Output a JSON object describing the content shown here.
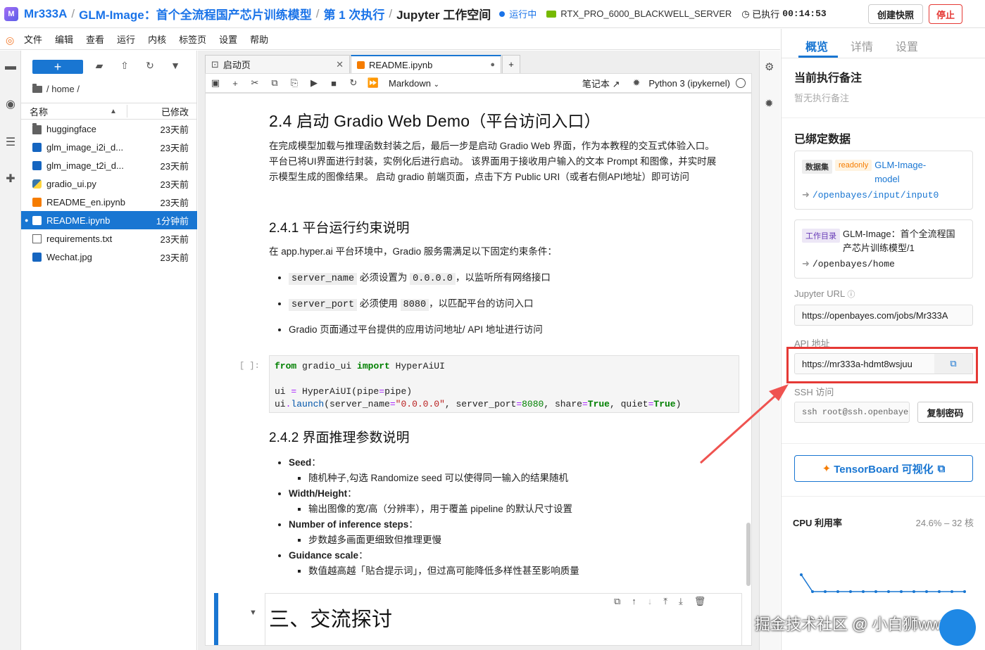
{
  "topbar": {
    "logo_text": "M",
    "user": "Mr333A",
    "project": "GLM-Image：首个全流程国产芯片训练模型",
    "run": "第 1 次执行",
    "workspace": "Jupyter 工作空间",
    "status": "运行中",
    "gpu": "RTX_PRO_6000_BLACKWELL_SERVER",
    "elapsed_label": "已执行",
    "elapsed": "00:14:53",
    "snapshot_button": "创建快照",
    "stop_button": "停止"
  },
  "menu": [
    "文件",
    "编辑",
    "查看",
    "运行",
    "内核",
    "标签页",
    "设置",
    "帮助"
  ],
  "filebrowser": {
    "path": "/ home /",
    "col_name": "名称",
    "col_modified": "已修改",
    "files": [
      {
        "name": "huggingface",
        "time": "23天前",
        "type": "folder"
      },
      {
        "name": "glm_image_i2i_d...",
        "time": "23天前",
        "type": "image"
      },
      {
        "name": "glm_image_t2i_d...",
        "time": "23天前",
        "type": "image"
      },
      {
        "name": "gradio_ui.py",
        "time": "23天前",
        "type": "python"
      },
      {
        "name": "README_en.ipynb",
        "time": "23天前",
        "type": "notebook"
      },
      {
        "name": "README.ipynb",
        "time": "1分钟前",
        "type": "notebook",
        "selected": true
      },
      {
        "name": "requirements.txt",
        "time": "23天前",
        "type": "text"
      },
      {
        "name": "Wechat.jpg",
        "time": "23天前",
        "type": "image"
      }
    ]
  },
  "tabs": [
    {
      "label": "启动页"
    },
    {
      "label": "README.ipynb"
    }
  ],
  "toolbar": {
    "cell_type": "Markdown",
    "notebook_label": "笔记本",
    "kernel": "Python 3 (ipykernel)"
  },
  "notebook": {
    "h_24": "2.4 启动 Gradio Web Demo（平台访问入口）",
    "p_24": "在完成模型加载与推理函数封装之后，最后一步是启动 Gradio Web 界面，作为本教程的交互式体验入口。 平台已将UI界面进行封装，实例化后进行启动。 该界面用于接收用户输入的文本 Prompt 和图像，并实时展示模型生成的图像结果。 启动 gradio 前端页面，点击下方 Public URI（或者右侧API地址）即可访问",
    "h_241": "2.4.1 平台运行约束说明",
    "p_241": "在 app.hyper.ai 平台环境中，Gradio 服务需满足以下固定约束条件：",
    "b1_code": "server_name",
    "b1_mid": "必须设置为",
    "b1_val": "0.0.0.0",
    "b1_tail": "，以监听所有网络接口",
    "b2_code": "server_port",
    "b2_mid": "必须使用",
    "b2_val": "8080",
    "b2_tail": "，以匹配平台的访问入口",
    "b3": "Gradio 页面通过平台提供的应用访问地址/ API 地址进行访问",
    "prompt": "[ ]:",
    "h_242": "2.4.2 界面推理参数说明",
    "params": [
      {
        "name": "Seed",
        "desc": "随机种子,勾选 Randomize seed 可以使得同一输入的结果随机"
      },
      {
        "name": "Width/Height",
        "desc": "输出图像的宽/高（分辨率），用于覆盖 pipeline 的默认尺寸设置"
      },
      {
        "name": "Number of inference steps",
        "desc": "步数越多画面更细致但推理更慢"
      },
      {
        "name": "Guidance scale",
        "desc": "数值越高越「贴合提示词」，但过高可能降低多样性甚至影响质量"
      }
    ],
    "h_3": "三、交流探讨"
  },
  "panel": {
    "tabs": [
      "概览",
      "详情",
      "设置"
    ],
    "note_title": "当前执行备注",
    "note_empty": "暂无执行备注",
    "data_title": "已绑定数据",
    "dataset_tag": "数据集",
    "readonly_tag": "readonly",
    "dataset_name": "GLM-Image-model",
    "dataset_path": "/openbayes/input/input0",
    "workdir_tag": "工作目录",
    "workdir_name": "GLM-Image：首个全流程国产芯片训练模型/1",
    "workdir_path": "/openbayes/home",
    "jupyter_label": "Jupyter URL",
    "jupyter_url": "https://openbayes.com/jobs/Mr333A",
    "api_label": "API 地址",
    "api_url": "https://mr333a-hdmt8wsjuu",
    "ssh_label": "SSH 访问",
    "ssh_value": "ssh root@ssh.openbayes",
    "copy_pw": "复制密码",
    "tensorboard": "TensorBoard 可视化",
    "cpu_label": "CPU 利用率",
    "cpu_value": "24.6% – 32 核"
  },
  "watermark": "掘金技术社区 @ 小白狮ww"
}
